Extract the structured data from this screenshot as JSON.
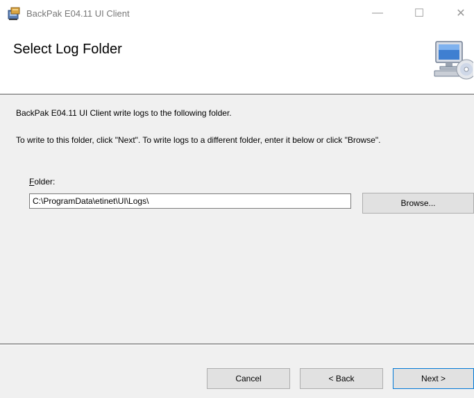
{
  "window": {
    "title": "BackPak E04.11 UI Client",
    "controls": {
      "minimize": "—",
      "maximize": "☐",
      "close": "✕"
    }
  },
  "header": {
    "title": "Select Log Folder",
    "graphic": "computer-disc-icon"
  },
  "content": {
    "description": "BackPak E04.11 UI Client write logs to the following folder.",
    "instructions": "To write to this folder, click \"Next\". To write logs to a different folder, enter it below or click \"Browse\".",
    "folder_label_mnemonic": "F",
    "folder_label_rest": "older:",
    "folder_value": "C:\\ProgramData\\etinet\\UI\\Logs\\",
    "browse_label": "Browse..."
  },
  "footer": {
    "cancel_label": "Cancel",
    "back_label": "< Back",
    "next_label": "Next >"
  },
  "colors": {
    "content_bg": "#f0f0f0",
    "button_bg": "#e1e1e1",
    "default_button_border": "#0078d7"
  }
}
